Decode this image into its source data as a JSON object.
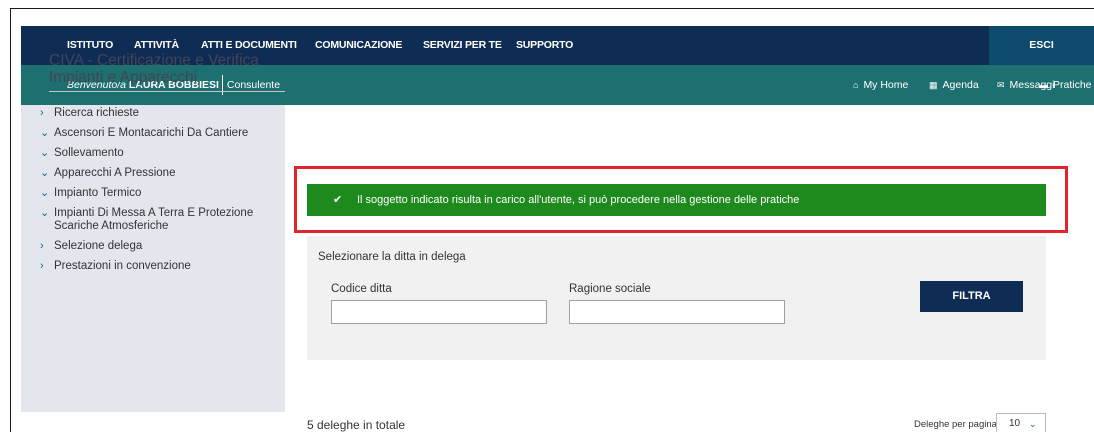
{
  "top_nav": {
    "items": [
      "ISTITUTO",
      "ATTIVITÀ",
      "ATTI E DOCUMENTI",
      "COMUNICAZIONE",
      "SERVIZI PER TE",
      "SUPPORTO"
    ],
    "logout_label": "ESCI"
  },
  "user_bar": {
    "welcome_label": "Benvenuto/a",
    "user_name": "LAURA BOBBIESI",
    "role": "Consulente",
    "quick_links": [
      {
        "icon": "home-icon",
        "glyph": "⌂",
        "label": "My Home"
      },
      {
        "icon": "calendar-icon",
        "glyph": "▦",
        "label": "Agenda"
      },
      {
        "icon": "envelope-icon",
        "glyph": "✉",
        "label": "Messaggi"
      },
      {
        "icon": "archive-icon",
        "glyph": "▬",
        "label": "Pratiche"
      }
    ]
  },
  "sidebar": {
    "title": "CIVA - Certificazione e Verifica Impianti e Apparecchi",
    "items": [
      {
        "label": "Ricerca richieste",
        "arrow": "›"
      },
      {
        "label": "Ascensori E Montacarichi Da Cantiere",
        "arrow": "⌄"
      },
      {
        "label": "Sollevamento",
        "arrow": "⌄"
      },
      {
        "label": "Apparecchi A Pressione",
        "arrow": "⌄"
      },
      {
        "label": "Impianto Termico",
        "arrow": "⌄"
      },
      {
        "label": "Impianti Di Messa A Terra E Protezione Scariche Atmosferiche",
        "arrow": "⌄"
      },
      {
        "label": "Selezione delega",
        "arrow": "›"
      },
      {
        "label": "Prestazioni in convenzione",
        "arrow": "›"
      }
    ]
  },
  "alert": {
    "icon": "check-icon",
    "glyph": "✔",
    "message": "Il soggetto indicato risulta in carico all'utente, si può procedere nella gestione delle pratiche"
  },
  "filter_panel": {
    "title": "Selezionare la ditta in delega",
    "codice_label": "Codice ditta",
    "codice_value": "",
    "ragione_label": "Ragione sociale",
    "ragione_value": "",
    "button_label": "FILTRA"
  },
  "results": {
    "total_label": "5 deleghe in totale",
    "per_page_label": "Deleghe per pagina",
    "per_page_value": "10",
    "per_page_chevron": "⌄"
  },
  "colors": {
    "top_nav": "#0f2d54",
    "user_bar": "#1e6f70",
    "alert_success": "#1e8a1e",
    "highlight_outline": "#e3242b",
    "sidebar_bg": "#e3e6ec"
  }
}
